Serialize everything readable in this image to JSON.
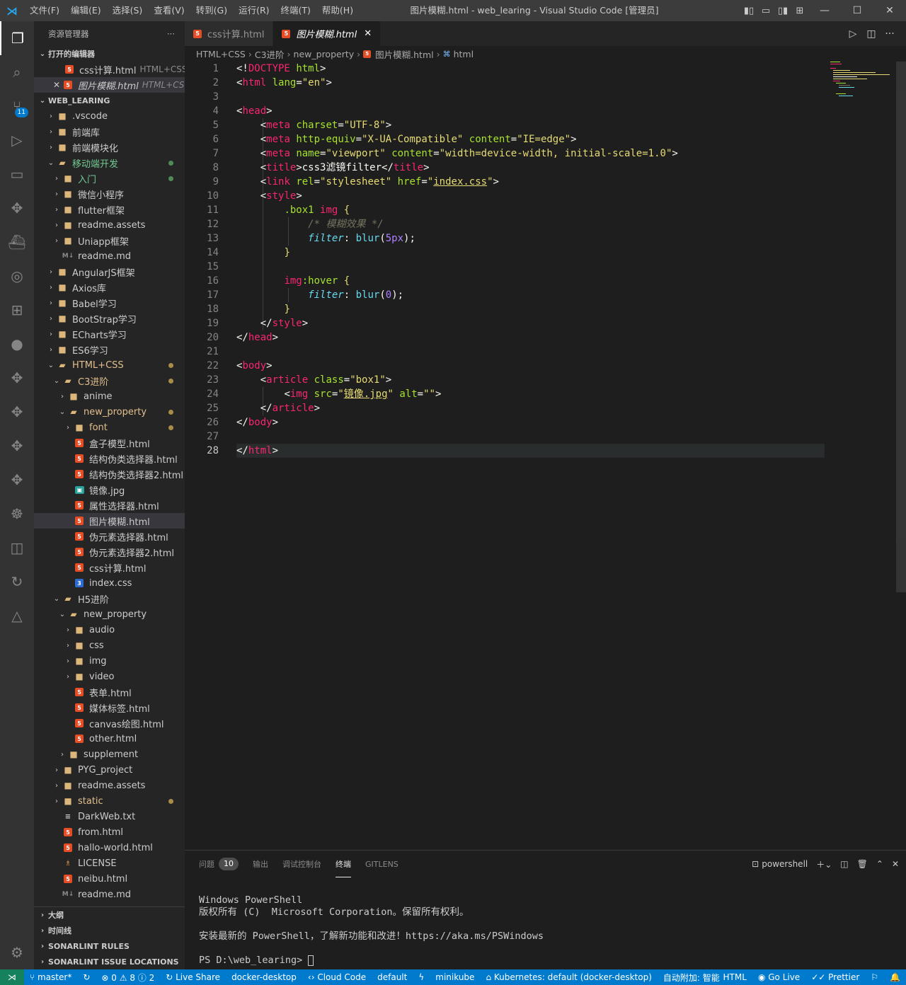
{
  "window": {
    "title": "图片模糊.html - web_learing - Visual Studio Code [管理员]",
    "menu": [
      "文件(F)",
      "编辑(E)",
      "选择(S)",
      "查看(V)",
      "转到(G)",
      "运行(R)",
      "终端(T)",
      "帮助(H)"
    ]
  },
  "activity": {
    "scm_badge": "11"
  },
  "sidebar": {
    "header": "资源管理器",
    "more": "···",
    "open_editors_title": "打开的编辑器",
    "open_editors": [
      {
        "name": "css计算.html",
        "desc": "HTML+CSS..."
      },
      {
        "name": "图片模糊.html",
        "desc": "HTML+CS..."
      }
    ],
    "workspace_title": "WEB_LEARING",
    "tree": [
      {
        "label": "",
        "indent": 0
      }
    ],
    "bottom_sections": [
      "大纲",
      "时间线",
      "SONARLINT RULES",
      "SONARLINT ISSUE LOCATIONS"
    ]
  },
  "tree": [
    {
      "label": ".vscode",
      "type": "folder",
      "level": 1,
      "chev": "›",
      "icon": "vs"
    },
    {
      "label": "前端库",
      "type": "folder",
      "level": 1,
      "chev": "›"
    },
    {
      "label": "前端模块化",
      "type": "folder",
      "level": 1,
      "chev": "›"
    },
    {
      "label": "移动端开发",
      "type": "folder",
      "level": 1,
      "chev": "⌄",
      "status": "mod",
      "dot": "g",
      "open": true
    },
    {
      "label": "入门",
      "type": "folder",
      "level": 2,
      "chev": "›",
      "status": "mod",
      "dot": "g"
    },
    {
      "label": "微信小程序",
      "type": "folder",
      "level": 2,
      "chev": "›"
    },
    {
      "label": "flutter框架",
      "type": "folder",
      "level": 2,
      "chev": "›"
    },
    {
      "label": "readme.assets",
      "type": "folder",
      "level": 2,
      "chev": "›"
    },
    {
      "label": "Uniapp框架",
      "type": "folder",
      "level": 2,
      "chev": "›"
    },
    {
      "label": "readme.md",
      "type": "md",
      "level": 2
    },
    {
      "label": "AngularJS框架",
      "type": "folder",
      "level": 1,
      "chev": "›"
    },
    {
      "label": "Axios库",
      "type": "folder",
      "level": 1,
      "chev": "›"
    },
    {
      "label": "Babel学习",
      "type": "folder",
      "level": 1,
      "chev": "›"
    },
    {
      "label": "BootStrap学习",
      "type": "folder",
      "level": 1,
      "chev": "›"
    },
    {
      "label": "ECharts学习",
      "type": "folder",
      "level": 1,
      "chev": "›"
    },
    {
      "label": "ES6学习",
      "type": "folder",
      "level": 1,
      "chev": "›"
    },
    {
      "label": "HTML+CSS",
      "type": "folder",
      "level": 1,
      "chev": "⌄",
      "status": "mod2",
      "dot": "y",
      "open": true
    },
    {
      "label": "C3进阶",
      "type": "folder",
      "level": 2,
      "chev": "⌄",
      "status": "mod2",
      "dot": "y",
      "open": true
    },
    {
      "label": "anime",
      "type": "folder",
      "level": 3,
      "chev": "›"
    },
    {
      "label": "new_property",
      "type": "folder",
      "level": 3,
      "chev": "⌄",
      "status": "mod2",
      "dot": "y",
      "open": true
    },
    {
      "label": "font",
      "type": "folder",
      "level": 4,
      "chev": "›",
      "status": "mod2",
      "dot": "y"
    },
    {
      "label": "盒子模型.html",
      "type": "html",
      "level": 4
    },
    {
      "label": "结构伪类选择器.html",
      "type": "html",
      "level": 4
    },
    {
      "label": "结构伪类选择器2.html",
      "type": "html",
      "level": 4
    },
    {
      "label": "镜像.jpg",
      "type": "img",
      "level": 4
    },
    {
      "label": "属性选择器.html",
      "type": "html",
      "level": 4
    },
    {
      "label": "图片模糊.html",
      "type": "html",
      "level": 4,
      "selected": true
    },
    {
      "label": "伪元素选择器.html",
      "type": "html",
      "level": 4
    },
    {
      "label": "伪元素选择器2.html",
      "type": "html",
      "level": 4
    },
    {
      "label": "css计算.html",
      "type": "html",
      "level": 4
    },
    {
      "label": "index.css",
      "type": "css",
      "level": 4
    },
    {
      "label": "H5进阶",
      "type": "folder",
      "level": 2,
      "chev": "⌄",
      "open": true
    },
    {
      "label": "new_property",
      "type": "folder",
      "level": 3,
      "chev": "⌄",
      "open": true
    },
    {
      "label": "audio",
      "type": "folder",
      "level": 4,
      "chev": "›",
      "icon": "audio"
    },
    {
      "label": "css",
      "type": "folder",
      "level": 4,
      "chev": "›",
      "icon": "css"
    },
    {
      "label": "img",
      "type": "folder",
      "level": 4,
      "chev": "›",
      "icon": "img"
    },
    {
      "label": "video",
      "type": "folder",
      "level": 4,
      "chev": "›",
      "icon": "video"
    },
    {
      "label": "表单.html",
      "type": "html",
      "level": 4
    },
    {
      "label": "媒体标签.html",
      "type": "html",
      "level": 4
    },
    {
      "label": "canvas绘图.html",
      "type": "html",
      "level": 4
    },
    {
      "label": "other.html",
      "type": "html",
      "level": 4
    },
    {
      "label": "supplement",
      "type": "folder",
      "level": 3,
      "chev": "›"
    },
    {
      "label": "PYG_project",
      "type": "folder",
      "level": 2,
      "chev": "›"
    },
    {
      "label": "readme.assets",
      "type": "folder",
      "level": 2,
      "chev": "›"
    },
    {
      "label": "static",
      "type": "folder",
      "level": 2,
      "chev": "›",
      "status": "mod2",
      "dot": "y"
    },
    {
      "label": "DarkWeb.txt",
      "type": "txt",
      "level": 2
    },
    {
      "label": "from.html",
      "type": "html",
      "level": 2
    },
    {
      "label": "hallo-world.html",
      "type": "html",
      "level": 2
    },
    {
      "label": "LICENSE",
      "type": "lic",
      "level": 2
    },
    {
      "label": "neibu.html",
      "type": "html",
      "level": 2
    },
    {
      "label": "readme.md",
      "type": "md",
      "level": 2
    }
  ],
  "tabs": [
    {
      "label": "css计算.html",
      "active": false
    },
    {
      "label": "图片模糊.html",
      "active": true,
      "close": "✕"
    }
  ],
  "breadcrumb": [
    "HTML+CSS",
    "C3进阶",
    "new_property",
    "图片模糊.html",
    "html"
  ],
  "code": [
    [
      [
        "m-br",
        "<!"
      ],
      [
        "m-tag",
        "DOCTYPE"
      ],
      [
        "m-w",
        " "
      ],
      [
        "m-attr",
        "html"
      ],
      [
        "m-br",
        ">"
      ]
    ],
    [
      [
        "m-br",
        "<"
      ],
      [
        "m-tag",
        "html"
      ],
      [
        "m-w",
        " "
      ],
      [
        "m-attr",
        "lang"
      ],
      [
        "m-br",
        "="
      ],
      [
        "m-str",
        "\"en\""
      ],
      [
        "m-br",
        ">"
      ]
    ],
    [],
    [
      [
        "m-br",
        "<"
      ],
      [
        "m-tag",
        "head"
      ],
      [
        "m-br",
        ">"
      ]
    ],
    [
      [
        "m-w",
        "    "
      ],
      [
        "m-br",
        "<"
      ],
      [
        "m-tag",
        "meta"
      ],
      [
        "m-w",
        " "
      ],
      [
        "m-attr",
        "charset"
      ],
      [
        "m-br",
        "="
      ],
      [
        "m-str",
        "\"UTF-8\""
      ],
      [
        "m-br",
        ">"
      ]
    ],
    [
      [
        "m-w",
        "    "
      ],
      [
        "m-br",
        "<"
      ],
      [
        "m-tag",
        "meta"
      ],
      [
        "m-w",
        " "
      ],
      [
        "m-attr",
        "http-equiv"
      ],
      [
        "m-br",
        "="
      ],
      [
        "m-str",
        "\"X-UA-Compatible\""
      ],
      [
        "m-w",
        " "
      ],
      [
        "m-attr",
        "content"
      ],
      [
        "m-br",
        "="
      ],
      [
        "m-str",
        "\"IE=edge\""
      ],
      [
        "m-br",
        ">"
      ]
    ],
    [
      [
        "m-w",
        "    "
      ],
      [
        "m-br",
        "<"
      ],
      [
        "m-tag",
        "meta"
      ],
      [
        "m-w",
        " "
      ],
      [
        "m-attr",
        "name"
      ],
      [
        "m-br",
        "="
      ],
      [
        "m-str",
        "\"viewport\""
      ],
      [
        "m-w",
        " "
      ],
      [
        "m-attr",
        "content"
      ],
      [
        "m-br",
        "="
      ],
      [
        "m-str",
        "\"width=device-width, initial-scale=1.0\""
      ],
      [
        "m-br",
        ">"
      ]
    ],
    [
      [
        "m-w",
        "    "
      ],
      [
        "m-br",
        "<"
      ],
      [
        "m-tag",
        "title"
      ],
      [
        "m-br",
        ">"
      ],
      [
        "m-w",
        "css3滤镜filter"
      ],
      [
        "m-br",
        "</"
      ],
      [
        "m-tag",
        "title"
      ],
      [
        "m-br",
        ">"
      ]
    ],
    [
      [
        "m-w",
        "    "
      ],
      [
        "m-br",
        "<"
      ],
      [
        "m-tag",
        "link"
      ],
      [
        "m-w",
        " "
      ],
      [
        "m-attr",
        "rel"
      ],
      [
        "m-br",
        "="
      ],
      [
        "m-str",
        "\"stylesheet\""
      ],
      [
        "m-w",
        " "
      ],
      [
        "m-attr",
        "href"
      ],
      [
        "m-br",
        "="
      ],
      [
        "m-str",
        "\""
      ],
      [
        "m-str u",
        "index.css"
      ],
      [
        "m-str",
        "\""
      ],
      [
        "m-br",
        ">"
      ]
    ],
    [
      [
        "m-w",
        "    "
      ],
      [
        "m-br",
        "<"
      ],
      [
        "m-tag",
        "style"
      ],
      [
        "m-br",
        ">"
      ]
    ],
    [
      [
        "m-w",
        "        "
      ],
      [
        "m-sel",
        ".box1"
      ],
      [
        "m-w",
        " "
      ],
      [
        "m-tag",
        "img"
      ],
      [
        "m-w",
        " "
      ],
      [
        "m-brace",
        "{"
      ]
    ],
    [
      [
        "m-w",
        "            "
      ],
      [
        "m-com",
        "/* 模糊效果 */"
      ]
    ],
    [
      [
        "m-w",
        "            "
      ],
      [
        "m-prop",
        "filter"
      ],
      [
        "m-w",
        ": "
      ],
      [
        "m-fn",
        "blur"
      ],
      [
        "m-w",
        "("
      ],
      [
        "m-num",
        "5px"
      ],
      [
        "m-w",
        ");"
      ]
    ],
    [
      [
        "m-w",
        "        "
      ],
      [
        "m-brace",
        "}"
      ]
    ],
    [],
    [
      [
        "m-w",
        "        "
      ],
      [
        "m-tag",
        "img"
      ],
      [
        "m-attr",
        ":hover"
      ],
      [
        "m-w",
        " "
      ],
      [
        "m-brace",
        "{"
      ]
    ],
    [
      [
        "m-w",
        "            "
      ],
      [
        "m-prop",
        "filter"
      ],
      [
        "m-w",
        ": "
      ],
      [
        "m-fn",
        "blur"
      ],
      [
        "m-w",
        "("
      ],
      [
        "m-num",
        "0"
      ],
      [
        "m-w",
        ");"
      ]
    ],
    [
      [
        "m-w",
        "        "
      ],
      [
        "m-brace",
        "}"
      ]
    ],
    [
      [
        "m-w",
        "    "
      ],
      [
        "m-br",
        "</"
      ],
      [
        "m-tag",
        "style"
      ],
      [
        "m-br",
        ">"
      ]
    ],
    [
      [
        "m-br",
        "</"
      ],
      [
        "m-tag",
        "head"
      ],
      [
        "m-br",
        ">"
      ]
    ],
    [],
    [
      [
        "m-br",
        "<"
      ],
      [
        "m-tag",
        "body"
      ],
      [
        "m-br",
        ">"
      ]
    ],
    [
      [
        "m-w",
        "    "
      ],
      [
        "m-br",
        "<"
      ],
      [
        "m-tag",
        "article"
      ],
      [
        "m-w",
        " "
      ],
      [
        "m-attr",
        "class"
      ],
      [
        "m-br",
        "="
      ],
      [
        "m-str",
        "\"box1\""
      ],
      [
        "m-br",
        ">"
      ]
    ],
    [
      [
        "m-w",
        "        "
      ],
      [
        "m-br",
        "<"
      ],
      [
        "m-tag",
        "img"
      ],
      [
        "m-w",
        " "
      ],
      [
        "m-attr",
        "src"
      ],
      [
        "m-br",
        "="
      ],
      [
        "m-str",
        "\""
      ],
      [
        "m-str u",
        "镜像.jpg"
      ],
      [
        "m-str",
        "\""
      ],
      [
        "m-w",
        " "
      ],
      [
        "m-attr",
        "alt"
      ],
      [
        "m-br",
        "="
      ],
      [
        "m-str",
        "\"\""
      ],
      [
        "m-br",
        ">"
      ]
    ],
    [
      [
        "m-w",
        "    "
      ],
      [
        "m-br",
        "</"
      ],
      [
        "m-tag",
        "article"
      ],
      [
        "m-br",
        ">"
      ]
    ],
    [
      [
        "m-br",
        "</"
      ],
      [
        "m-tag",
        "body"
      ],
      [
        "m-br",
        ">"
      ]
    ],
    [],
    [
      [
        "m-br",
        "</"
      ],
      [
        "m-tag",
        "html"
      ],
      [
        "m-br",
        ">"
      ]
    ]
  ],
  "panel": {
    "tabs": [
      "问题",
      "输出",
      "调试控制台",
      "终端",
      "GITLENS"
    ],
    "problems_count": "10",
    "active": "终端",
    "shell": "powershell",
    "terminal": [
      "Windows PowerShell",
      "版权所有 (C)  Microsoft Corporation。保留所有权利。",
      "",
      "安装最新的 PowerShell，了解新功能和改进！https://aka.ms/PSWindows",
      "",
      "PS D:\\web_learing> "
    ]
  },
  "statusbar": {
    "branch": "master*",
    "errors": "0",
    "warnings": "8",
    "infos": "2",
    "left": [
      "Live Share",
      "docker-desktop",
      "Cloud Code",
      "default",
      "minikube",
      "Kubernetes: default (docker-desktop)",
      "自动附加: 智能"
    ],
    "right": [
      "HTML",
      "Go Live",
      "Prettier"
    ]
  }
}
